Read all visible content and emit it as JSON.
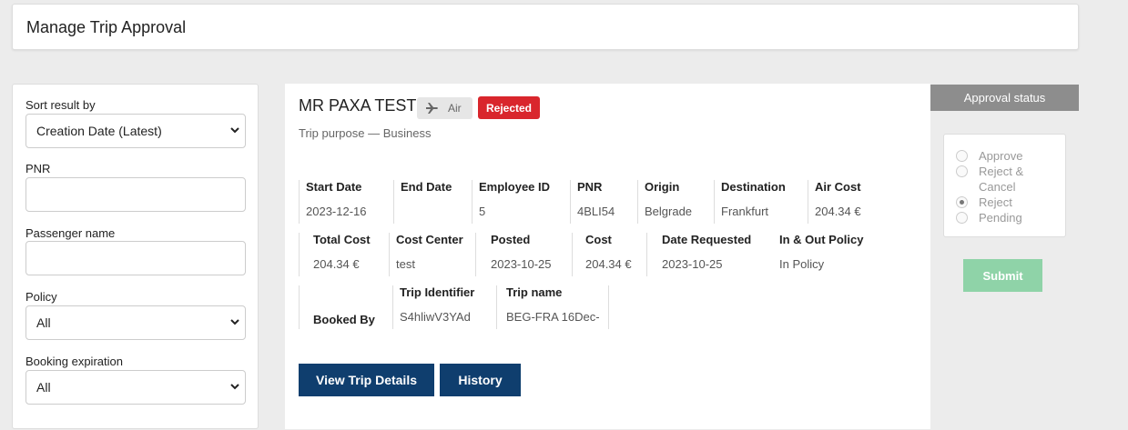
{
  "page": {
    "title": "Manage Trip Approval"
  },
  "filters": {
    "sort_label": "Sort result by",
    "sort_value": "Creation Date (Latest)",
    "pnr_label": "PNR",
    "pnr_value": "",
    "passenger_label": "Passenger name",
    "passenger_value": "",
    "policy_label": "Policy",
    "policy_value": "All",
    "booking_exp_label": "Booking expiration",
    "booking_exp_value": "All"
  },
  "trip": {
    "passenger": "MR PAXA TEST",
    "mode_label": "Air",
    "mode_icon": "airplane-icon",
    "status": "Rejected",
    "status_color": "#d9262c",
    "purpose": "Trip purpose — Business",
    "fields": {
      "start_date": {
        "label": "Start Date",
        "value": "2023-12-16"
      },
      "end_date": {
        "label": "End Date",
        "value": ""
      },
      "employee_id": {
        "label": "Employee ID",
        "value": "5"
      },
      "pnr": {
        "label": "PNR",
        "value": "4BLI54"
      },
      "origin": {
        "label": "Origin",
        "value": "Belgrade"
      },
      "destination": {
        "label": "Destination",
        "value": "Frankfurt"
      },
      "air_cost": {
        "label": "Air Cost",
        "value": "204.34 €"
      },
      "total_cost": {
        "label": "Total Cost",
        "value": "204.34 €"
      },
      "cost_center": {
        "label": "Cost Center",
        "value": "test"
      },
      "posted": {
        "label": "Posted",
        "value": "2023-10-25"
      },
      "cost": {
        "label": "Cost",
        "value": "204.34 €"
      },
      "date_requested": {
        "label": "Date Requested",
        "value": "2023-10-25"
      },
      "policy": {
        "label": "In & Out Policy",
        "value": "In Policy"
      },
      "booked_by": {
        "label": "Booked By",
        "value": ""
      },
      "trip_identifier": {
        "label": "Trip Identifier",
        "value": "S4hliwV3YAd"
      },
      "trip_name": {
        "label": "Trip name",
        "value": "BEG-FRA 16Dec-"
      }
    },
    "buttons": {
      "view_details": "View Trip Details",
      "history": "History"
    }
  },
  "approval": {
    "header": "Approval status",
    "options": [
      {
        "label": "Approve",
        "checked": false
      },
      {
        "label": "Reject & Cancel",
        "checked": false
      },
      {
        "label": "Reject",
        "checked": true
      },
      {
        "label": "Pending",
        "checked": false
      }
    ],
    "submit_label": "Submit",
    "submit_color": "#8fd3a8"
  }
}
